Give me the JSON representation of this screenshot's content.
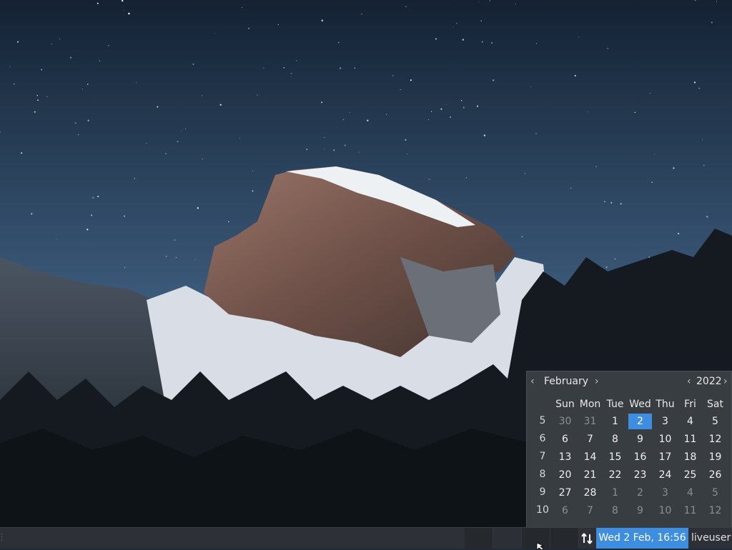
{
  "calendar": {
    "month": "February",
    "year": "2022",
    "weekday_headers": [
      "Sun",
      "Mon",
      "Tue",
      "Wed",
      "Thu",
      "Fri",
      "Sat"
    ],
    "weeks": [
      {
        "week": "5",
        "days": [
          "30",
          "31",
          "1",
          "2",
          "3",
          "4",
          "5"
        ],
        "dim": [
          true,
          true,
          false,
          false,
          false,
          false,
          false
        ]
      },
      {
        "week": "6",
        "days": [
          "6",
          "7",
          "8",
          "9",
          "10",
          "11",
          "12"
        ],
        "dim": [
          false,
          false,
          false,
          false,
          false,
          false,
          false
        ]
      },
      {
        "week": "7",
        "days": [
          "13",
          "14",
          "15",
          "16",
          "17",
          "18",
          "19"
        ],
        "dim": [
          false,
          false,
          false,
          false,
          false,
          false,
          false
        ]
      },
      {
        "week": "8",
        "days": [
          "20",
          "21",
          "22",
          "23",
          "24",
          "25",
          "26"
        ],
        "dim": [
          false,
          false,
          false,
          false,
          false,
          false,
          false
        ]
      },
      {
        "week": "9",
        "days": [
          "27",
          "28",
          "1",
          "2",
          "3",
          "4",
          "5"
        ],
        "dim": [
          false,
          false,
          true,
          true,
          true,
          true,
          true
        ]
      },
      {
        "week": "10",
        "days": [
          "6",
          "7",
          "8",
          "9",
          "10",
          "11",
          "12"
        ],
        "dim": [
          true,
          true,
          true,
          true,
          true,
          true,
          true
        ]
      }
    ],
    "selected": {
      "week_index": 0,
      "day_index": 3
    },
    "prev_icon": "chevron-left-icon",
    "next_icon": "chevron-right-icon"
  },
  "taskbar": {
    "clock": "Wed  2 Feb, 16:56",
    "user": "liveuser",
    "network_icon": "network-transfer-icon",
    "accent": "#3d8ee0"
  }
}
